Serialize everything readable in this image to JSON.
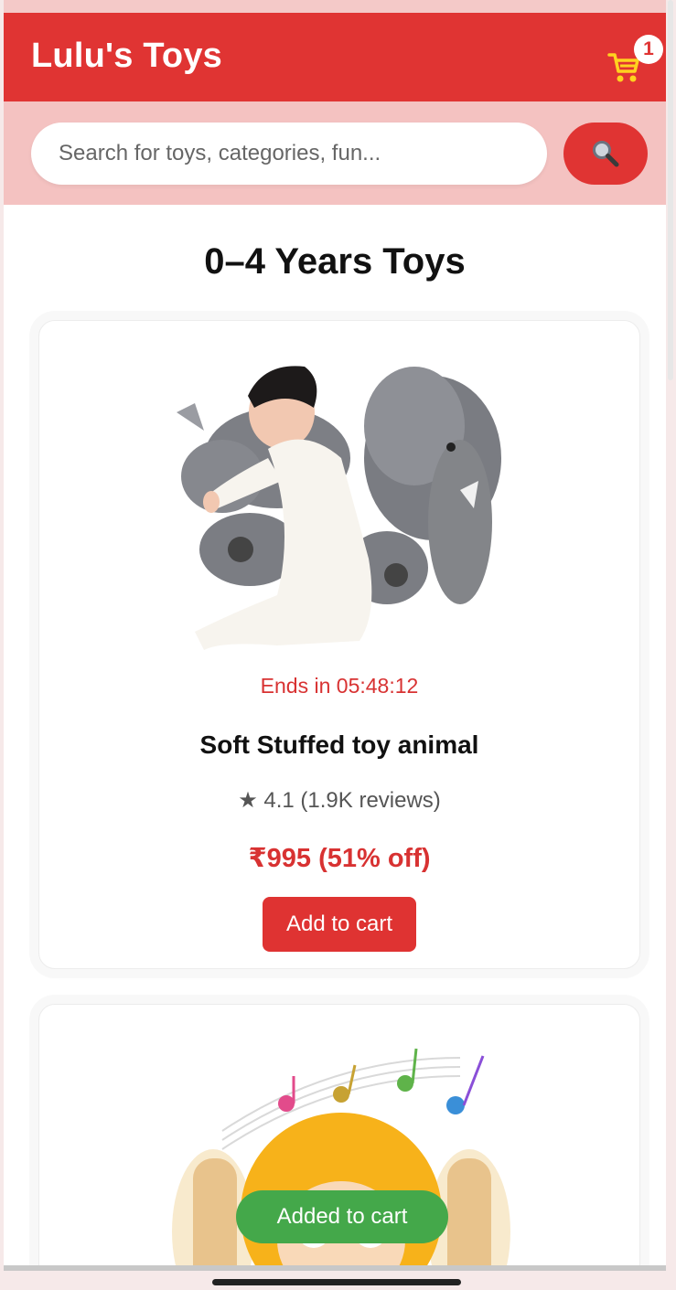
{
  "header": {
    "brand": "Lulu's Toys",
    "cart_count": "1",
    "cart_icon": "cart-icon"
  },
  "search": {
    "placeholder": "Search for toys, categories, fun...",
    "button_icon": "magnifier-icon"
  },
  "section": {
    "title": "0–4 Years Toys"
  },
  "products": [
    {
      "timer": "Ends in 05:48:12",
      "name": "Soft Stuffed toy animal",
      "rating": "★ 4.1 (1.9K reviews)",
      "price": "₹995 (51% off)",
      "button": "Add to cart"
    }
  ],
  "toast": {
    "message": "Added to cart"
  },
  "colors": {
    "primary": "#e03433",
    "search_band": "#f4c2c1",
    "cart_icon": "#ffd21f",
    "toast": "#44a84a"
  }
}
